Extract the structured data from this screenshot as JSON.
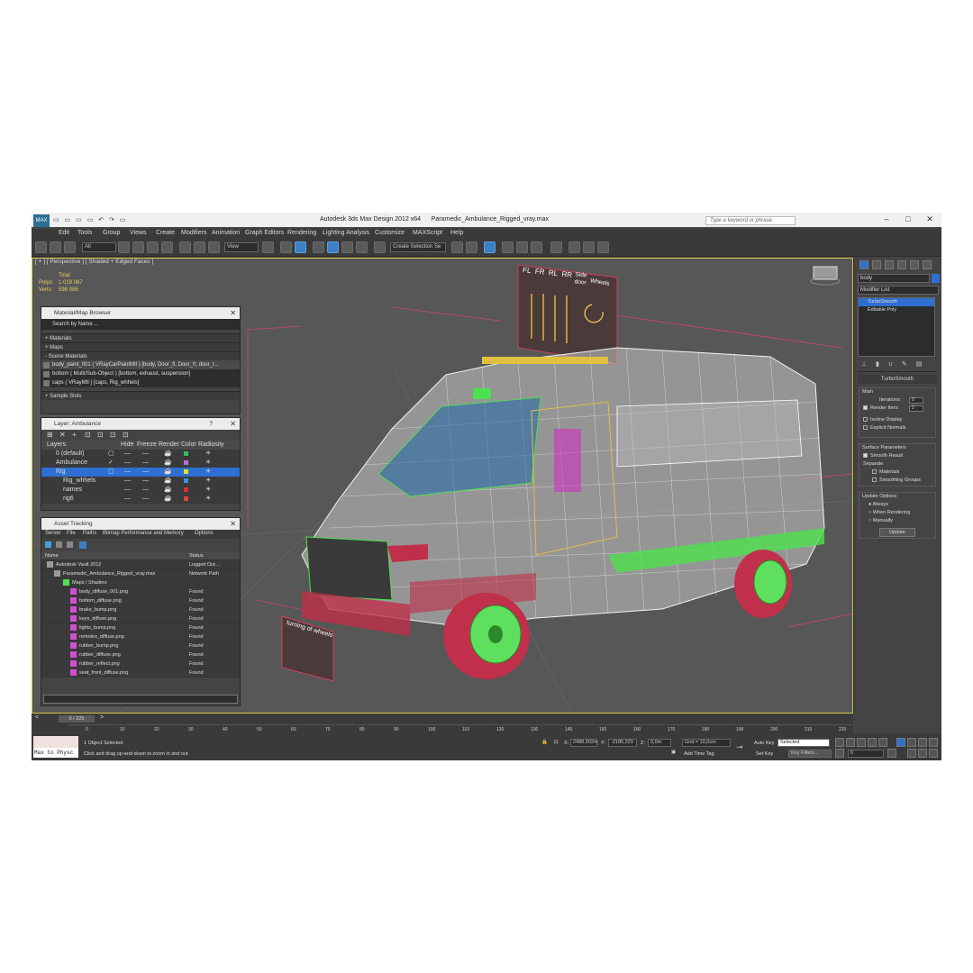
{
  "window": {
    "app_title": "Autodesk 3ds Max Design 2012 x64",
    "file_title": "Paramedic_Ambulance_Rigged_vray.max",
    "search_placeholder": "Type a keyword or phrase",
    "logo_text": "MAX"
  },
  "menu": [
    "Edit",
    "Tools",
    "Group",
    "Views",
    "Create",
    "Modifiers",
    "Animation",
    "Graph Editors",
    "Rendering",
    "Lighting Analysis",
    "Customize",
    "MAXScript",
    "Help"
  ],
  "toolbar": {
    "selection_filter": "All",
    "ref_coord": "View",
    "named_selection": "Create Selection Se"
  },
  "viewport": {
    "label": "[ + ] [ Perspective ] [ Shaded + Edged Faces ]",
    "stats_header": "Total",
    "polys_label": "Polys:",
    "polys_value": "1 019 087",
    "verts_label": "Verts:",
    "verts_value": "598 086",
    "rig_labels": [
      "FL",
      "FR",
      "RL",
      "RR",
      "Side door",
      "Wheels"
    ],
    "rig_labels_2": "turning of wheels"
  },
  "material_browser": {
    "title": "Material/Map Browser",
    "search_placeholder": "Search by Name ...",
    "sections": [
      "+ Materials",
      "+ Maps",
      "- Scene Materials"
    ],
    "scene_materials": [
      "body_paint_001  ( VRayCarPaintMtl ) [body, Door_fl, Door_fr, door_r...",
      "bottom  ( Multi/Sub-Object ) [bottom, exhaust, suspension]",
      "caps  ( VRayMtl ) [caps, Rig_whhels]"
    ],
    "sample_slots": "+ Sample Slots"
  },
  "layer_panel": {
    "title": "Layer: Ambulance",
    "help": "?",
    "headers": [
      "Layers",
      "Hide",
      "Freeze",
      "Render",
      "Color",
      "Radiosity"
    ],
    "layers": [
      {
        "name": "0 (default)"
      },
      {
        "name": "Ambulance"
      },
      {
        "name": "Rig"
      },
      {
        "name": "Rig_whhels"
      },
      {
        "name": "names"
      },
      {
        "name": "rig6"
      }
    ],
    "colors": [
      "#30c060",
      "#c070d0",
      "#e0e030",
      "#4090e0",
      "#e03030",
      "#e04040"
    ]
  },
  "asset_tracking": {
    "title": "Asset Tracking",
    "menu": [
      "Server",
      "File",
      "Paths",
      "Bitmap Performance and Memory",
      "Options"
    ],
    "headers": [
      "Name",
      "Status"
    ],
    "rows": [
      {
        "name": "Autodesk Vault 2012",
        "status": "Logged Out ..."
      },
      {
        "name": "Paramedic_Ambulance_Rigged_vray.max",
        "status": "Network Path"
      },
      {
        "name": "Maps / Shaders",
        "status": ""
      },
      {
        "name": "body_diffuse_001.png",
        "status": "Found"
      },
      {
        "name": "bottom_diffuse.png",
        "status": "Found"
      },
      {
        "name": "brake_bump.png",
        "status": "Found"
      },
      {
        "name": "keys_diffuse.png",
        "status": "Found"
      },
      {
        "name": "lights_bump.png",
        "status": "Found"
      },
      {
        "name": "remotes_diffuse.png",
        "status": "Found"
      },
      {
        "name": "rubber_bump.png",
        "status": "Found"
      },
      {
        "name": "rubber_diffuse.png",
        "status": "Found"
      },
      {
        "name": "rubber_reflect.png",
        "status": "Found"
      },
      {
        "name": "seat_front_diffuse.png",
        "status": "Found"
      }
    ]
  },
  "command_panel": {
    "object_name": "body",
    "modifier_list": "Modifier List",
    "stack": [
      "TurboSmooth",
      "Editable Poly"
    ],
    "rollout_title": "TurboSmooth",
    "main_group": "Main",
    "iterations_label": "Iterations:",
    "iterations_value": "0",
    "render_iters_label": "Render Iters:",
    "render_iters_value": "2",
    "isoline": "Isoline Display",
    "explicit": "Explicit Normals",
    "surface_group": "Surface Parameters",
    "smooth_result": "Smooth Result",
    "separate": "Separate",
    "materials": "Materials",
    "smoothing_groups": "Smoothing Groups",
    "update_group": "Update Options",
    "always": "Always",
    "when_rendering": "When Rendering",
    "manually": "Manually",
    "update_btn": "Update"
  },
  "timeline": {
    "frame": "0 / 225",
    "ticks": [
      "0",
      "10",
      "20",
      "30",
      "40",
      "50",
      "60",
      "70",
      "80",
      "90",
      "100",
      "110",
      "120",
      "130",
      "140",
      "150",
      "160",
      "170",
      "180",
      "190",
      "200",
      "210",
      "220"
    ]
  },
  "status": {
    "maxscript_line": "Max to Physc",
    "selected": "1 Object Selected",
    "prompt": "Click and drag up-and-down to zoom in and out",
    "x_label": "X:",
    "x_value": "2488,902m",
    "y_label": "Y:",
    "y_value": "-2185,229",
    "z_label": "Z:",
    "z_value": "0,0m",
    "grid": "Grid = 10,0cm",
    "add_time_tag": "Add Time Tag",
    "auto_key": "Auto Key",
    "set_key": "Set Key",
    "selected_dropdown": "Selected",
    "key_filters": "Key Filters...",
    "frame_field": "0"
  }
}
